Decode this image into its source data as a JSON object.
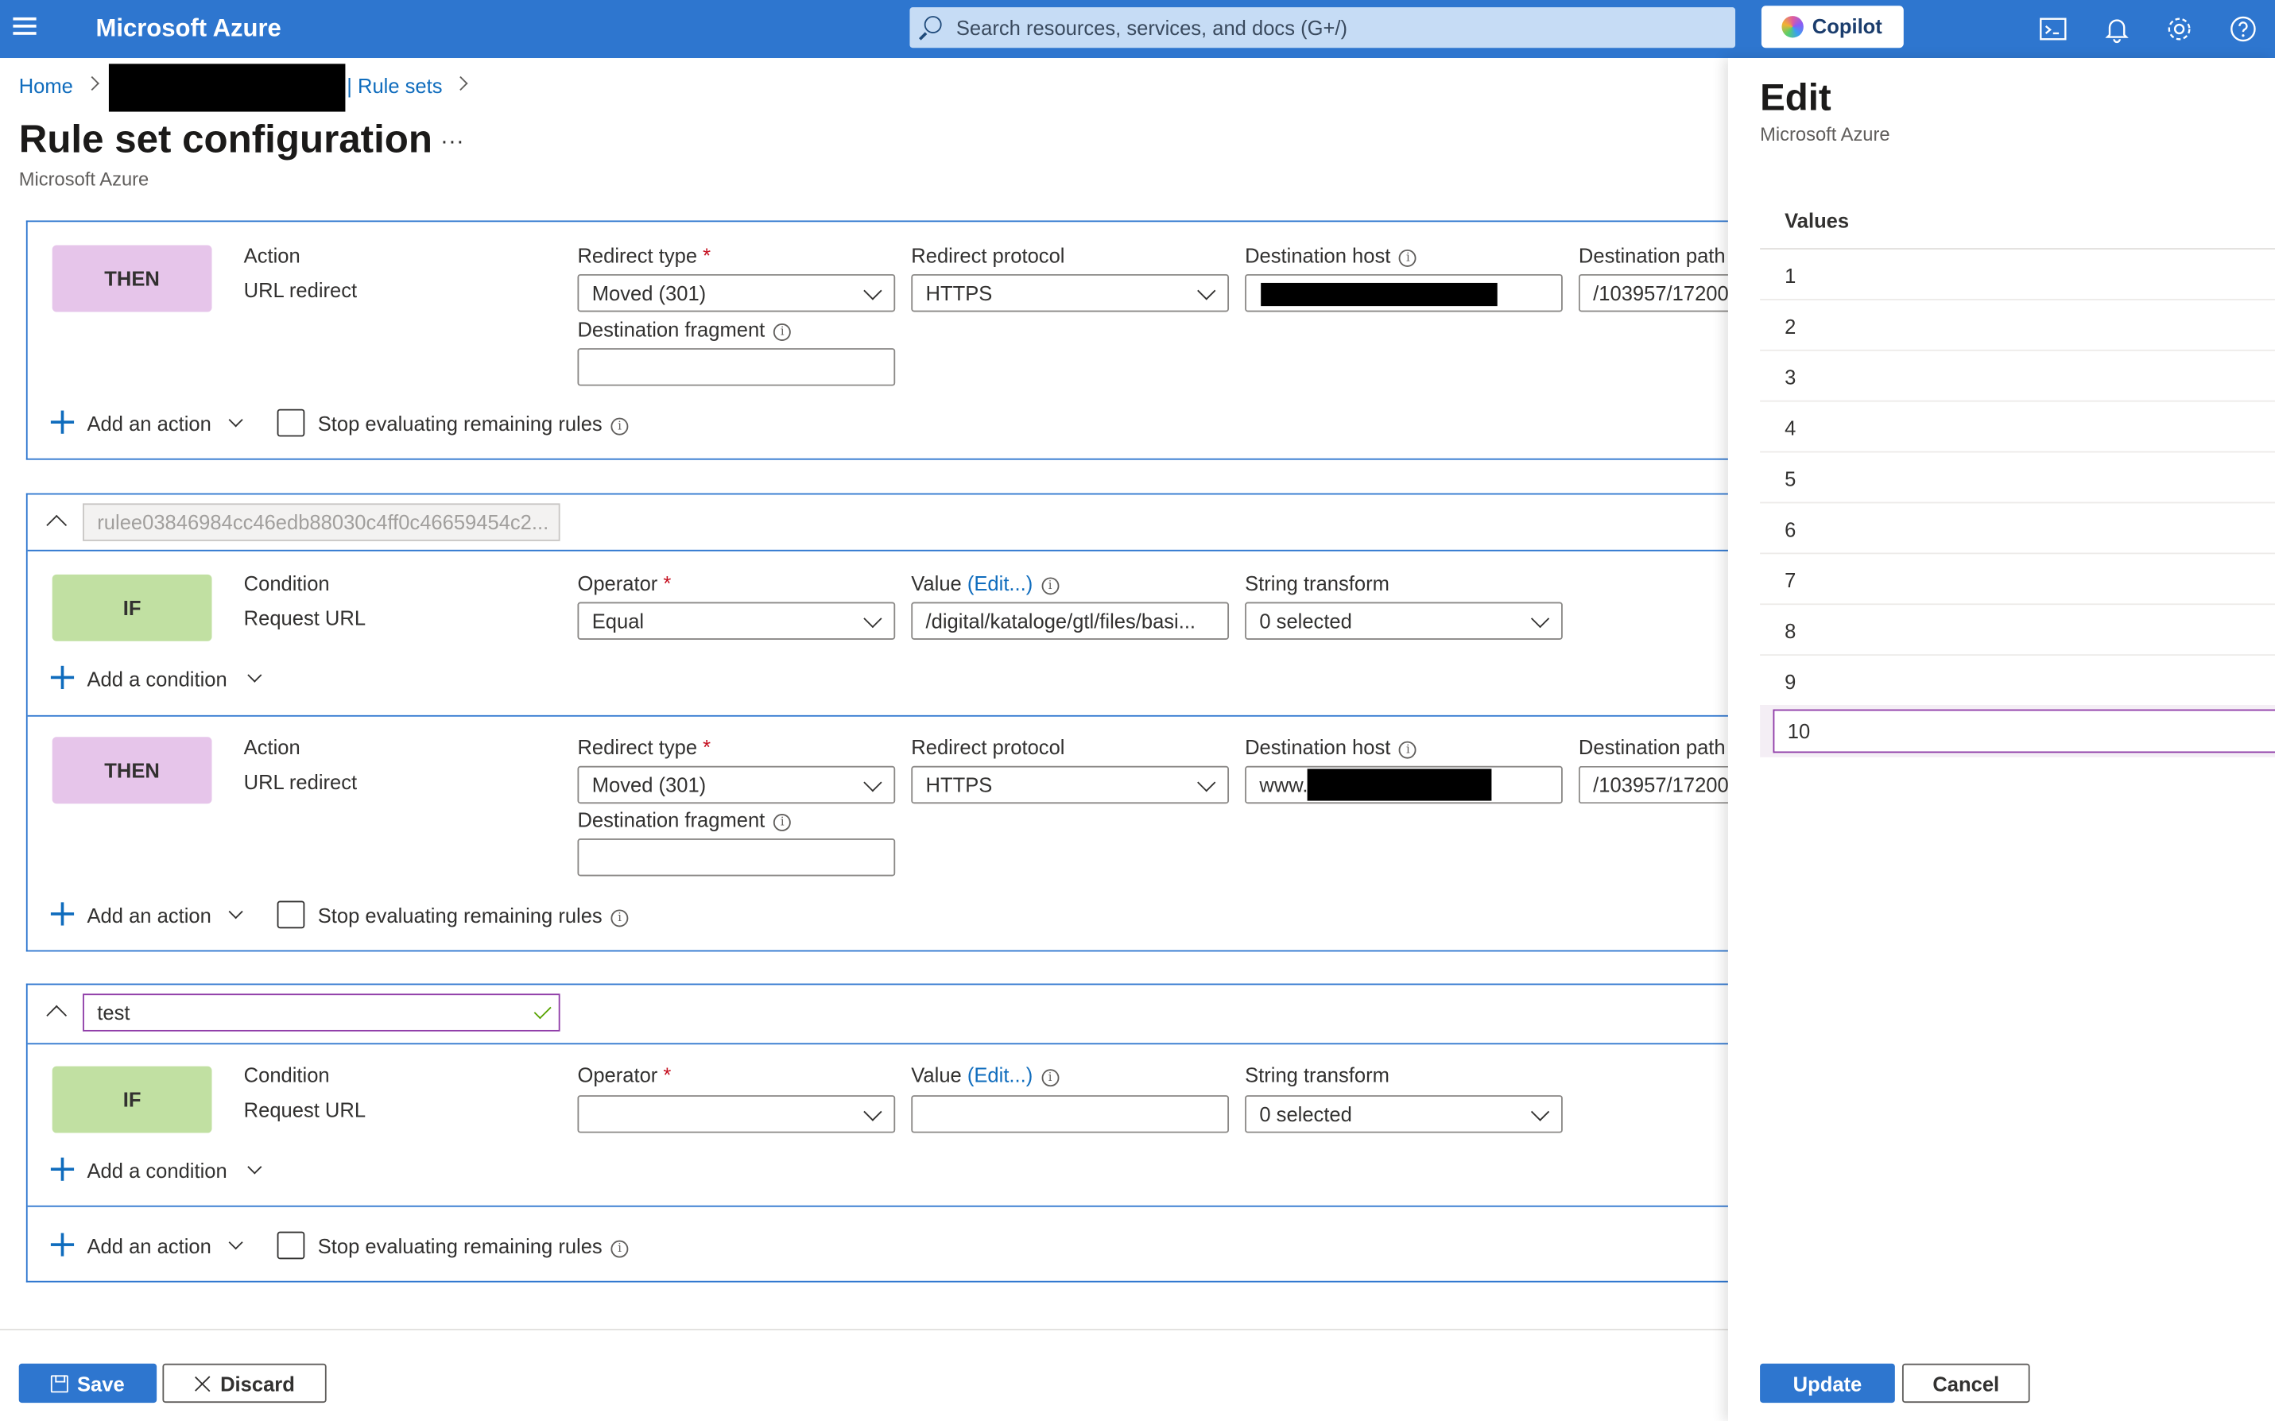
{
  "topbar": {
    "brand": "Microsoft Azure",
    "search_placeholder": "Search resources, services, and docs (G+/)",
    "copilot_label": "Copilot"
  },
  "breadcrumb": {
    "home": "Home",
    "rule_sets": "| Rule sets"
  },
  "page": {
    "title": "Rule set configuration",
    "ellipsis": "...",
    "subtitle": "Microsoft Azure"
  },
  "labels": {
    "then": "THEN",
    "if": "IF",
    "action": "Action",
    "url_redirect": "URL redirect",
    "condition": "Condition",
    "request_url": "Request URL",
    "redirect_type": "Redirect type",
    "redirect_protocol": "Redirect protocol",
    "destination_host": "Destination host",
    "destination_path": "Destination path",
    "destination_fragment": "Destination fragment",
    "operator": "Operator",
    "value": "Value",
    "edit_link": "(Edit...)",
    "string_transform": "String transform",
    "add_action": "Add an action",
    "add_condition": "Add a condition",
    "stop_evaluating": "Stop evaluating remaining rules",
    "required": "*"
  },
  "rule1": {
    "redirect_type": "Moved (301)",
    "redirect_protocol": "HTTPS",
    "destination_path": "/103957/17200",
    "destination_fragment": ""
  },
  "rule2": {
    "name": "rulee03846984cc46edb88030c4ff0c46659454c2...",
    "operator": "Equal",
    "value": "/digital/kataloge/gtl/files/basi...",
    "string_transform": "0 selected",
    "redirect_type": "Moved (301)",
    "redirect_protocol": "HTTPS",
    "destination_host": "www.",
    "destination_path": "/103957/17200",
    "destination_fragment": ""
  },
  "rule3": {
    "name": "test",
    "operator": "",
    "value": "",
    "string_transform": "0 selected"
  },
  "footer": {
    "save": "Save",
    "discard": "Discard"
  },
  "panel": {
    "title": "Edit",
    "subtitle": "Microsoft Azure",
    "values_header": "Values",
    "values": [
      "1",
      "2",
      "3",
      "4",
      "5",
      "6",
      "7",
      "8",
      "9"
    ],
    "current_value": "10",
    "update": "Update",
    "cancel": "Cancel"
  },
  "colors": {
    "azure_blue": "#2e76cf",
    "then_badge": "#e6c5ea",
    "if_badge": "#c1e0a2",
    "focus_purple": "#8e3aa7"
  }
}
